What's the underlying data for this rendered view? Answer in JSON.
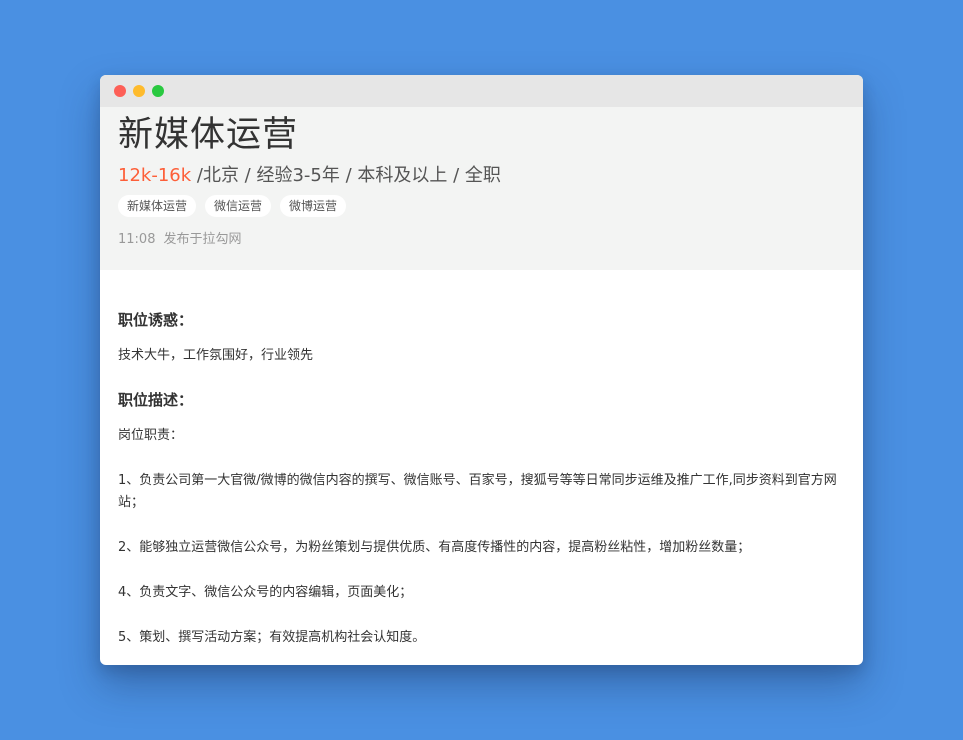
{
  "window": {
    "buttons": [
      "close",
      "minimize",
      "maximize"
    ]
  },
  "job": {
    "title": "新媒体运营",
    "salary": "12k-16k",
    "meta": " /北京 / 经验3-5年 / 本科及以上 / 全职",
    "tags": [
      "新媒体运营",
      "微信运营",
      "微博运营"
    ],
    "publish_time": "11:08",
    "publish_source": "发布于拉勾网"
  },
  "content": {
    "advantage_title": "职位诱惑：",
    "advantage_text": "技术大牛，工作氛围好，行业领先",
    "description_title": "职位描述：",
    "duties_label": "岗位职责：",
    "duties": [
      "1、负责公司第一大官微/微博的微信内容的撰写、微信账号、百家号，搜狐号等等日常同步运维及推广工作,同步资料到官方网站；",
      "2、能够独立运营微信公众号，为粉丝策划与提供优质、有高度传播性的内容，提高粉丝粘性，增加粉丝数量；",
      "4、负责文字、微信公众号的内容编辑，页面美化；",
      "5、策划、撰写活动方案；有效提高机构社会认知度。"
    ]
  },
  "colors": {
    "background": "#4a90e2",
    "salary": "#fd5f39",
    "close": "#fd5f57",
    "minimize": "#febb2d",
    "maximize": "#29c940"
  }
}
